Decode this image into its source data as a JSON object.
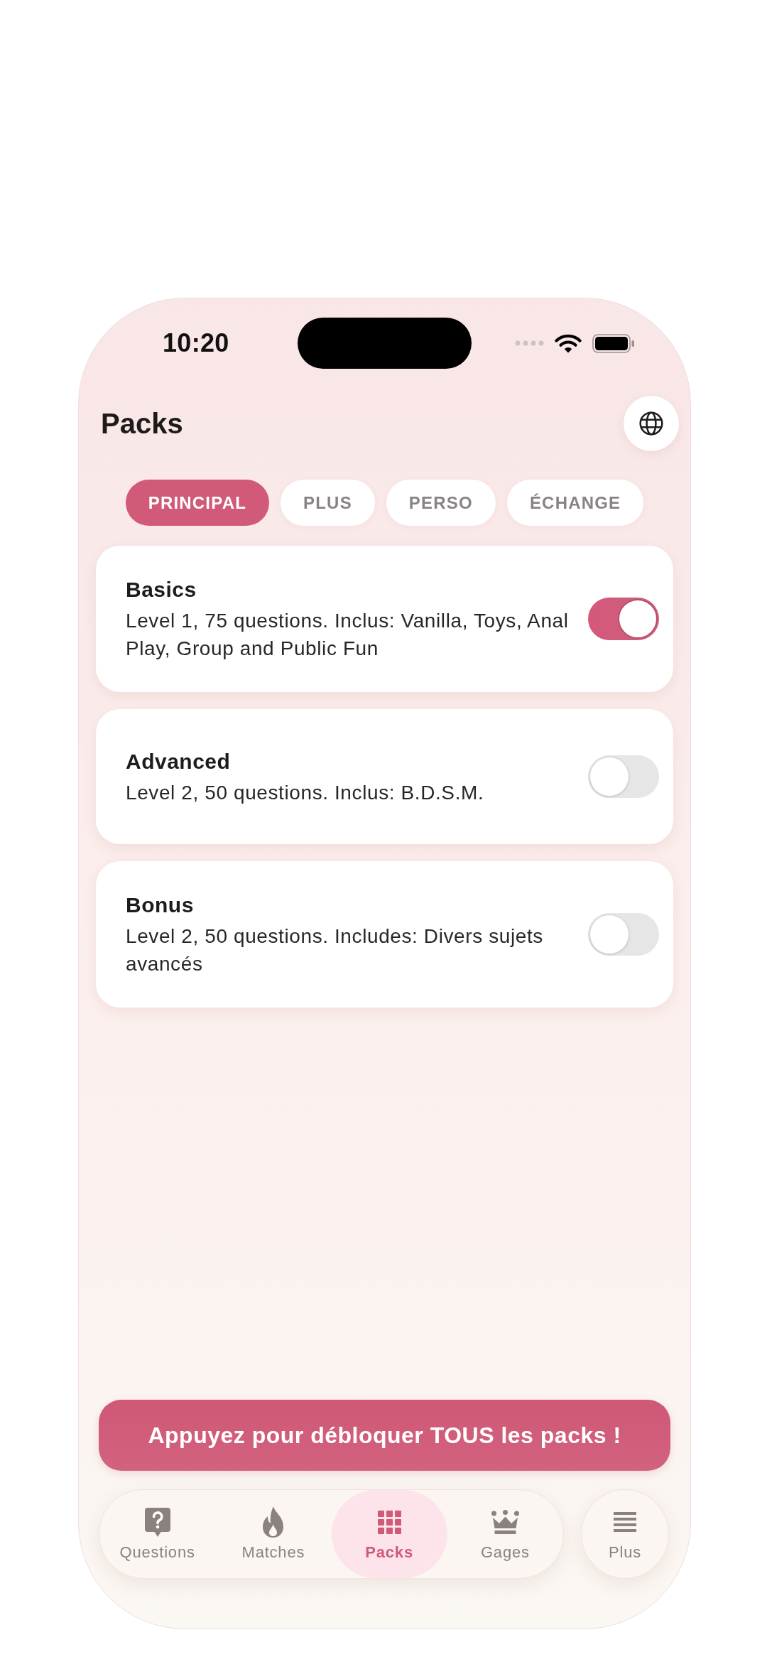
{
  "status_bar": {
    "time": "10:20"
  },
  "header": {
    "title": "Packs"
  },
  "tabs": [
    {
      "label": "PRINCIPAL",
      "selected": true
    },
    {
      "label": "PLUS",
      "selected": false
    },
    {
      "label": "PERSO",
      "selected": false
    },
    {
      "label": "ÉCHANGE",
      "selected": false
    }
  ],
  "packs": [
    {
      "title": "Basics",
      "description": "Level 1, 75 questions. Inclus: Vanilla, Toys, Anal Play, Group and Public Fun",
      "on": true
    },
    {
      "title": "Advanced",
      "description": "Level 2, 50 questions. Inclus: B.D.S.M.",
      "on": false
    },
    {
      "title": "Bonus",
      "description": "Level 2, 50 questions. Includes: Divers sujets avancés",
      "on": false
    }
  ],
  "unlock_button": {
    "label": "Appuyez pour débloquer TOUS les packs !"
  },
  "nav": [
    {
      "kind": "question",
      "label": "Questions",
      "selected": false
    },
    {
      "kind": "flame",
      "label": "Matches",
      "selected": false
    },
    {
      "kind": "grid",
      "label": "Packs",
      "selected": true
    },
    {
      "kind": "crown",
      "label": "Gages",
      "selected": false
    }
  ],
  "more_button": {
    "label": "Plus"
  }
}
